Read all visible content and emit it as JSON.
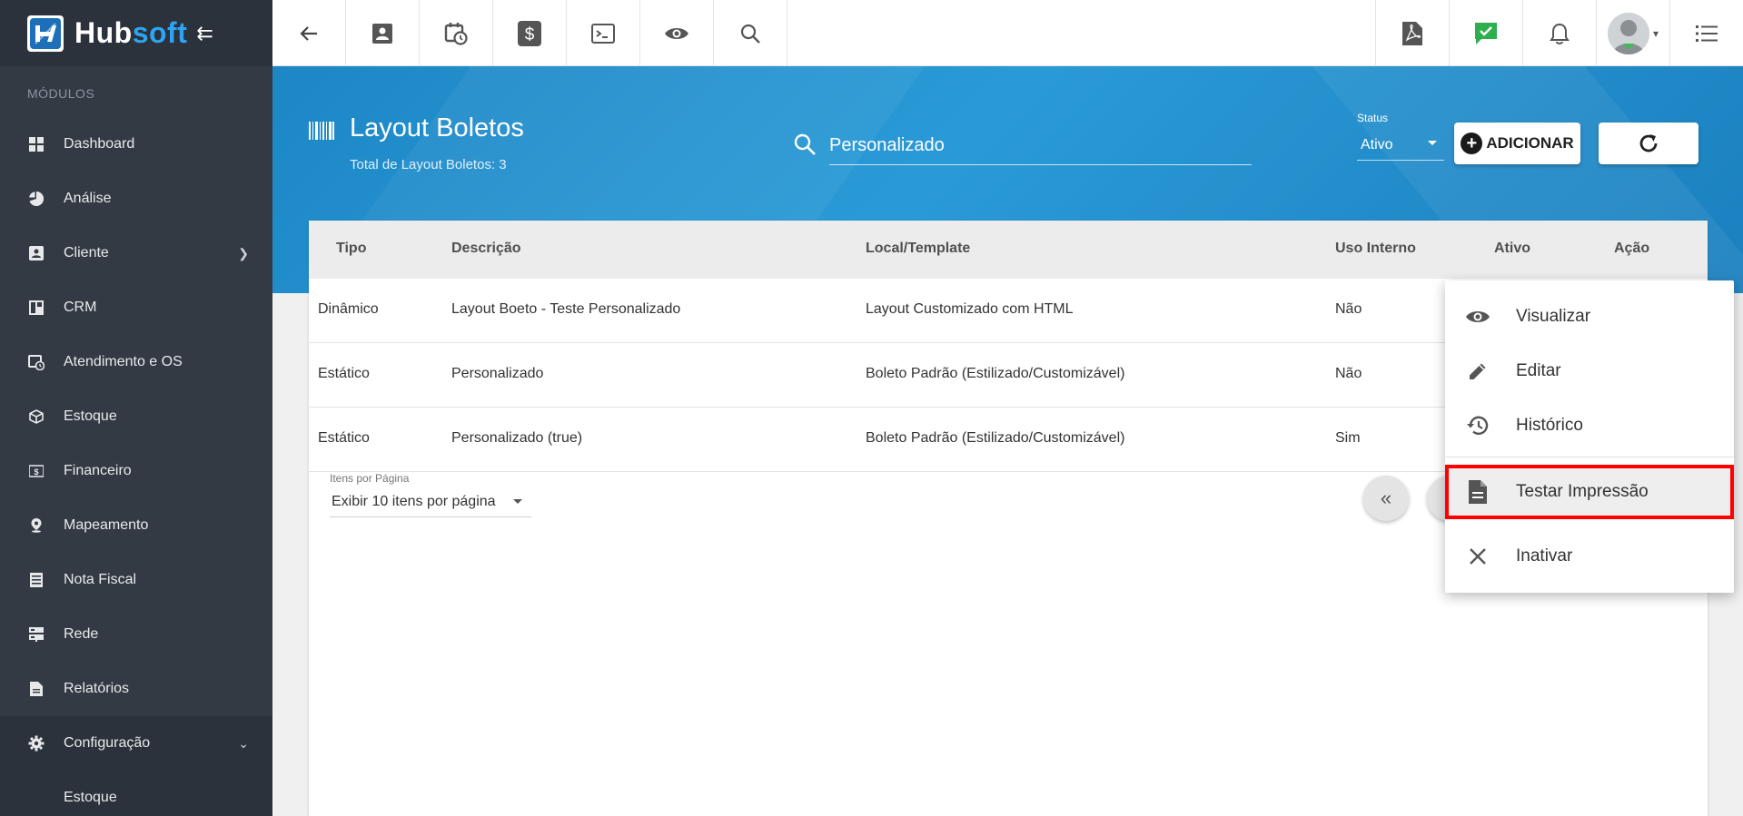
{
  "brand": {
    "name_prefix": "Hub",
    "name_suffix": "soft"
  },
  "sidebar": {
    "section_label": "MÓDULOS",
    "items": [
      {
        "label": "Dashboard",
        "icon": "dashboard-icon"
      },
      {
        "label": "Análise",
        "icon": "pie-chart-icon"
      },
      {
        "label": "Cliente",
        "icon": "contact-card-icon"
      },
      {
        "label": "CRM",
        "icon": "board-icon"
      },
      {
        "label": "Atendimento e OS",
        "icon": "calendar-clock-icon"
      },
      {
        "label": "Estoque",
        "icon": "box-icon"
      },
      {
        "label": "Financeiro",
        "icon": "money-icon"
      },
      {
        "label": "Mapeamento",
        "icon": "map-pin-icon"
      },
      {
        "label": "Nota Fiscal",
        "icon": "invoice-icon"
      },
      {
        "label": "Rede",
        "icon": "server-icon"
      },
      {
        "label": "Relatórios",
        "icon": "document-icon"
      },
      {
        "label": "Configuração",
        "icon": "gear-icon"
      }
    ],
    "sub_item": "Estoque"
  },
  "header": {
    "title": "Layout Boletos",
    "subtitle": "Total de Layout Boletos: 3",
    "search_value": "Personalizado",
    "status_label": "Status",
    "status_value": "Ativo",
    "add_label": "ADICIONAR"
  },
  "table": {
    "columns": [
      "Tipo",
      "Descrição",
      "Local/Template",
      "Uso Interno",
      "Ativo",
      "Ação"
    ],
    "rows": [
      [
        "Dinâmico",
        "Layout Boeto - Teste Personalizado",
        "Layout Customizado com HTML",
        "Não"
      ],
      [
        "Estático",
        "Personalizado",
        "Boleto Padrão (Estilizado/Customizável)",
        "Não"
      ],
      [
        "Estático",
        "Personalizado (true)",
        "Boleto Padrão (Estilizado/Customizável)",
        "Sim"
      ]
    ]
  },
  "pagination": {
    "items_per_page_label": "Itens por Página",
    "items_per_page_value": "Exibir 10 itens por página"
  },
  "action_menu": {
    "items": [
      "Visualizar",
      "Editar",
      "Histórico",
      "Testar Impressão",
      "Inativar"
    ],
    "highlight_color": "#ff0000"
  },
  "colors": {
    "hero": "#1d87c6",
    "sidebar": "#333a44",
    "accent": "#2ea3f2"
  }
}
